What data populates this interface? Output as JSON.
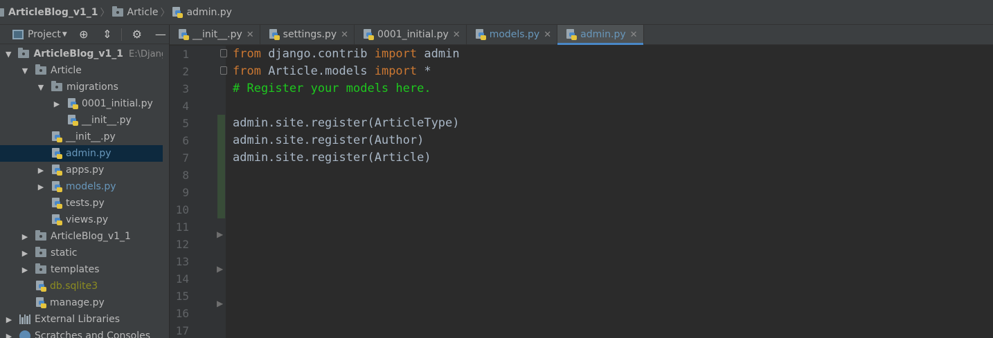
{
  "breadcrumb": {
    "project": "ArticleBlog_v1_1",
    "folder": "Article",
    "file": "admin.py"
  },
  "project_panel": {
    "title": "Project",
    "tree": [
      {
        "label": "ArticleBlog_v1_1",
        "path": "E:\\Django",
        "type": "folder",
        "expanded": true,
        "bold": true,
        "level": 0
      },
      {
        "label": "Article",
        "type": "folder",
        "expanded": true,
        "level": 1
      },
      {
        "label": "migrations",
        "type": "folder",
        "expanded": true,
        "level": 2
      },
      {
        "label": "0001_initial.py",
        "type": "py",
        "expandable": true,
        "level": 3
      },
      {
        "label": "__init__.py",
        "type": "py",
        "level": 3
      },
      {
        "label": "__init__.py",
        "type": "py",
        "level": 2
      },
      {
        "label": "admin.py",
        "type": "py",
        "level": 2,
        "selected": true,
        "color": "blue"
      },
      {
        "label": "apps.py",
        "type": "py",
        "expandable": true,
        "level": 2
      },
      {
        "label": "models.py",
        "type": "py",
        "expandable": true,
        "level": 2,
        "color": "blue"
      },
      {
        "label": "tests.py",
        "type": "py",
        "level": 2
      },
      {
        "label": "views.py",
        "type": "py",
        "level": 2
      },
      {
        "label": "ArticleBlog_v1_1",
        "type": "folder",
        "expandable": true,
        "level": 1
      },
      {
        "label": "static",
        "type": "folder",
        "expandable": true,
        "level": 1
      },
      {
        "label": "templates",
        "type": "folder",
        "expandable": true,
        "level": 1
      },
      {
        "label": "db.sqlite3",
        "type": "py",
        "level": 1,
        "color": "olive"
      },
      {
        "label": "manage.py",
        "type": "py",
        "level": 1
      },
      {
        "label": "External Libraries",
        "type": "lib",
        "expandable": true,
        "level": 0
      },
      {
        "label": "Scratches and Consoles",
        "type": "scratch",
        "expandable": true,
        "level": 0
      }
    ]
  },
  "tabs": [
    {
      "label": "__init__.py",
      "active": false
    },
    {
      "label": "settings.py",
      "active": false
    },
    {
      "label": "0001_initial.py",
      "active": false
    },
    {
      "label": "models.py",
      "active": false,
      "color": "blue"
    },
    {
      "label": "admin.py",
      "active": true,
      "color": "blue"
    }
  ],
  "editor": {
    "line_numbers": [
      "1",
      "2",
      "3",
      "4",
      "5",
      "6",
      "7",
      "8",
      "9",
      "10",
      "11",
      "12",
      "13",
      "14",
      "15",
      "16",
      "17"
    ],
    "lines": [
      [
        {
          "t": "from",
          "c": "kw"
        },
        {
          "t": " django.contrib ",
          "c": ""
        },
        {
          "t": "import",
          "c": "kw"
        },
        {
          "t": " admin",
          "c": ""
        }
      ],
      [
        {
          "t": "from",
          "c": "kw"
        },
        {
          "t": " Article.models ",
          "c": ""
        },
        {
          "t": "import",
          "c": "kw"
        },
        {
          "t": " *",
          "c": ""
        }
      ],
      [
        {
          "t": "# Register your models here.",
          "c": "cmt"
        }
      ],
      [],
      [
        {
          "t": "admin.site.register(ArticleType)",
          "c": ""
        }
      ],
      [
        {
          "t": "admin.site.register(Author)",
          "c": ""
        }
      ],
      [
        {
          "t": "admin.site.register(Article)",
          "c": ""
        }
      ]
    ]
  },
  "colors": {
    "keyword": "#cc7832",
    "comment": "#1ec81e",
    "code": "#a9b7c6",
    "accent": "#4a88c7"
  }
}
